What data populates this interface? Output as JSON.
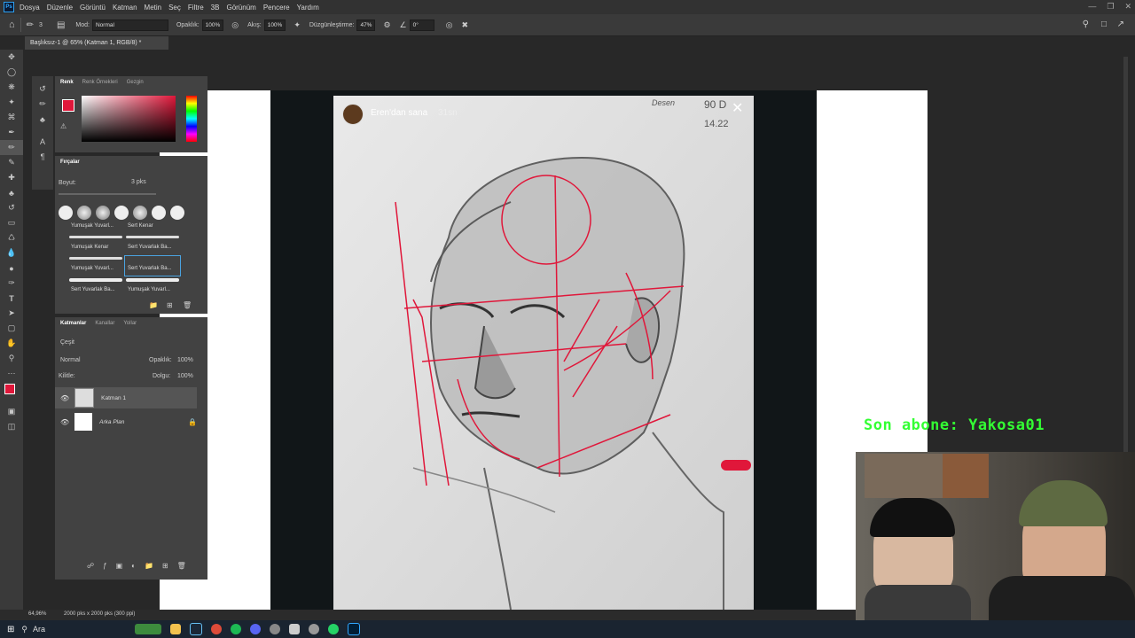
{
  "app": {
    "logo": "Ps"
  },
  "menu": [
    "Dosya",
    "Düzenle",
    "Görüntü",
    "Katman",
    "Metin",
    "Seç",
    "Filtre",
    "3B",
    "Görünüm",
    "Pencere",
    "Yardım"
  ],
  "options": {
    "size_value": "3",
    "mode_label": "Mod:",
    "mode_value": "Normal",
    "opacity_label": "Opaklık:",
    "opacity_value": "100%",
    "flow_label": "Akış:",
    "flow_value": "100%",
    "smoothing_label": "Düzgünleştirme:",
    "smoothing_value": "47%",
    "angle_value": "0°"
  },
  "document": {
    "tab_title": "Başlıksız-1 @ 65% (Katman 1, RGB/8) *"
  },
  "color_panel": {
    "tabs": [
      "Renk",
      "Renk Örnekleri",
      "Gezgin"
    ],
    "fg_color": "#e0173a"
  },
  "brush_panel": {
    "title": "Fırçalar",
    "size_label": "Boyut:",
    "size_value": "3 pks",
    "brushes": [
      "Yumuşak Yuvarl...",
      "Sert Kenar",
      "Yumuşak Kenar",
      "Sert Yuvarlak Ba...",
      "Yumuşak Yuvarl...",
      "Sert Yuvarlak Ba...",
      "Sert Yuvarlak Ba...",
      "Yumuşak Yuvarl..."
    ]
  },
  "layers_panel": {
    "tabs": [
      "Katmanlar",
      "Kanallar",
      "Yollar"
    ],
    "filter_label": "Çeşit",
    "blend_mode": "Normal",
    "opacity_label": "Opaklık:",
    "opacity_value": "100%",
    "lock_label": "Kilitle:",
    "fill_label": "Dolgu:",
    "fill_value": "100%",
    "layers": [
      {
        "name": "Katman 1"
      },
      {
        "name": "Arka Plan"
      }
    ]
  },
  "status": {
    "zoom": "64,96%",
    "doc_size": "2000 pks x 2000 pks (300 ppi)"
  },
  "story": {
    "sender": "Eren'dan sana",
    "time": "31sn",
    "sketch_note1": "Desen",
    "sketch_note2": "90 D",
    "sketch_note3": "14.22"
  },
  "overlay": {
    "subscriber": "Son abone: Yakosa01"
  },
  "taskbar": {
    "search_placeholder": "Ara"
  },
  "colors": {
    "accent_green": "#33ff33",
    "sketch_red": "#e0173a",
    "ps_blue": "#31a8ff"
  }
}
